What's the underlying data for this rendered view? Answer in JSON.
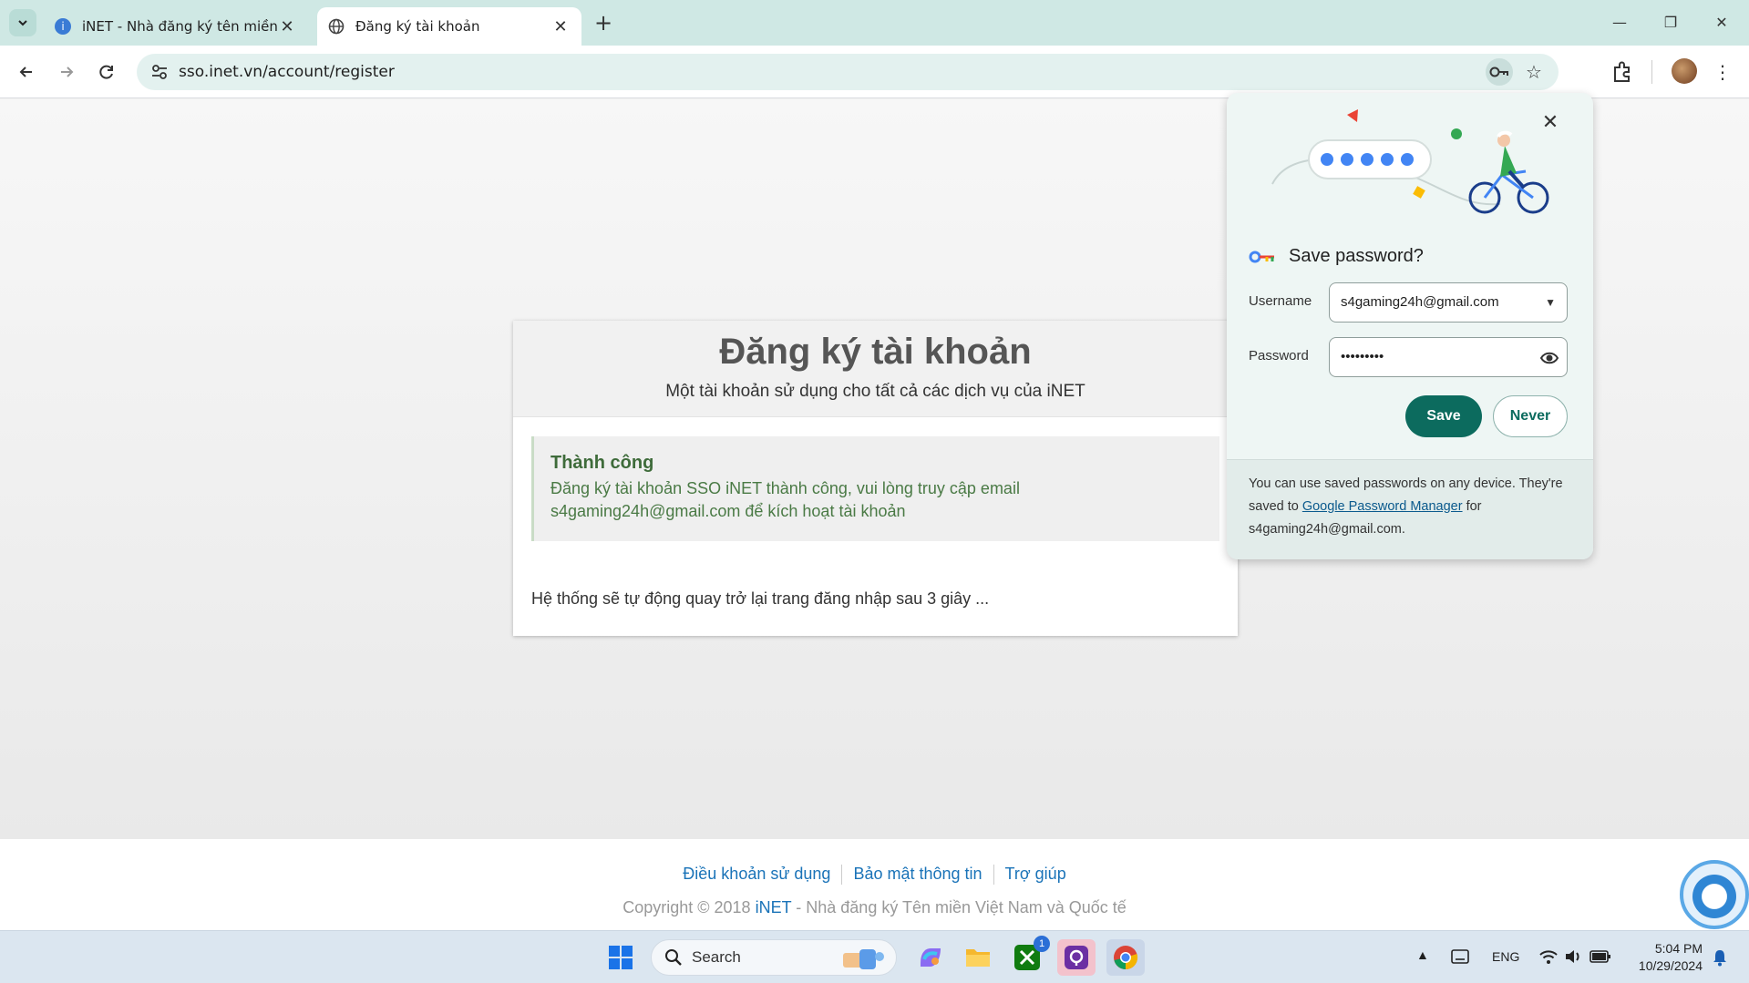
{
  "browser": {
    "tabs": [
      {
        "title": "iNET - Nhà đăng ký tên miền hợ",
        "active": false
      },
      {
        "title": "Đăng ký tài khoản",
        "active": true
      }
    ],
    "new_tab": "+",
    "url": "sso.inet.vn/account/register",
    "window_controls": {
      "minimize": "—",
      "restore": "❐",
      "close": "✕"
    }
  },
  "page": {
    "title": "Đăng ký tài khoản",
    "subtitle": "Một tài khoản sử dụng cho tất cả các dịch vụ của iNET",
    "alert": {
      "title": "Thành công",
      "message_line1": "Đăng ký tài khoản SSO iNET thành công, vui lòng truy cập email",
      "message_line2": "s4gaming24h@gmail.com để kích hoạt tài khoản"
    },
    "redirect_notice": "Hệ thống sẽ tự động quay trở lại trang đăng nhập sau 3 giây ...",
    "footer": {
      "links": [
        "Điều khoản sử dụng",
        "Bảo mật thông tin",
        "Trợ giúp"
      ],
      "copyright_prefix": "Copyright © 2018 ",
      "brand": "iNET",
      "copyright_suffix": " - Nhà đăng ký Tên miền Việt Nam và Quốc tế"
    }
  },
  "password_bubble": {
    "title": "Save password?",
    "username_label": "Username",
    "username_value": "s4gaming24h@gmail.com",
    "password_label": "Password",
    "password_value": "•••••••••",
    "save_label": "Save",
    "never_label": "Never",
    "footer_text_1": "You can use saved passwords on any device. They're saved to ",
    "footer_link": "Google Password Manager",
    "footer_text_2": " for s4gaming24h@gmail.com."
  },
  "taskbar": {
    "search_label": "Search",
    "xbox_badge": "1",
    "language": "ENG",
    "time": "5:04 PM",
    "date": "10/29/2024"
  },
  "colors": {
    "accent": "#0c6b5e",
    "link": "#1a73b8",
    "success": "#3e6b3a"
  }
}
